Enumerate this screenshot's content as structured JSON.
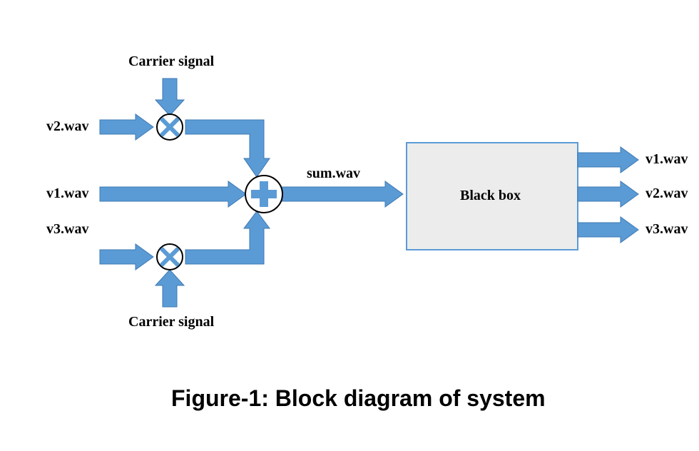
{
  "colors": {
    "arrow": "#5B9BD5",
    "arrow_stroke": "#3E78B3",
    "box_fill": "#ECECEC",
    "box_stroke": "#5B9BD5",
    "circle_stroke": "#000000",
    "text": "#000000"
  },
  "labels": {
    "carrier_top": "Carrier signal",
    "carrier_bottom": "Carrier signal",
    "in_v2": "v2.wav",
    "in_v1": "v1.wav",
    "in_v3": "v3.wav",
    "sum": "sum.wav",
    "box": "Black box",
    "out_v1": "v1.wav",
    "out_v2": "v2.wav",
    "out_v3": "v3.wav"
  },
  "caption": "Figure-1: Block diagram of system",
  "diagram": {
    "description": "Signal processing block diagram: three input audio signals (v1.wav direct, v2.wav and v3.wav each multiplied by a carrier signal) are summed into sum.wav, passed through a Black box, which outputs v1.wav, v2.wav, v3.wav.",
    "nodes": [
      {
        "id": "in_v2",
        "type": "input",
        "label": "v2.wav"
      },
      {
        "id": "in_v1",
        "type": "input",
        "label": "v1.wav"
      },
      {
        "id": "in_v3",
        "type": "input",
        "label": "v3.wav"
      },
      {
        "id": "carrier_top",
        "type": "input",
        "label": "Carrier signal"
      },
      {
        "id": "carrier_bottom",
        "type": "input",
        "label": "Carrier signal"
      },
      {
        "id": "mult_top",
        "type": "multiplier"
      },
      {
        "id": "mult_bottom",
        "type": "multiplier"
      },
      {
        "id": "summer",
        "type": "summer"
      },
      {
        "id": "sum_signal",
        "type": "signal",
        "label": "sum.wav"
      },
      {
        "id": "black_box",
        "type": "block",
        "label": "Black box"
      },
      {
        "id": "out_v1",
        "type": "output",
        "label": "v1.wav"
      },
      {
        "id": "out_v2",
        "type": "output",
        "label": "v2.wav"
      },
      {
        "id": "out_v3",
        "type": "output",
        "label": "v3.wav"
      }
    ],
    "edges": [
      {
        "from": "in_v2",
        "to": "mult_top"
      },
      {
        "from": "carrier_top",
        "to": "mult_top"
      },
      {
        "from": "in_v1",
        "to": "summer"
      },
      {
        "from": "in_v3",
        "to": "mult_bottom"
      },
      {
        "from": "carrier_bottom",
        "to": "mult_bottom"
      },
      {
        "from": "mult_top",
        "to": "summer"
      },
      {
        "from": "mult_bottom",
        "to": "summer"
      },
      {
        "from": "summer",
        "to": "black_box",
        "label": "sum.wav"
      },
      {
        "from": "black_box",
        "to": "out_v1"
      },
      {
        "from": "black_box",
        "to": "out_v2"
      },
      {
        "from": "black_box",
        "to": "out_v3"
      }
    ]
  }
}
